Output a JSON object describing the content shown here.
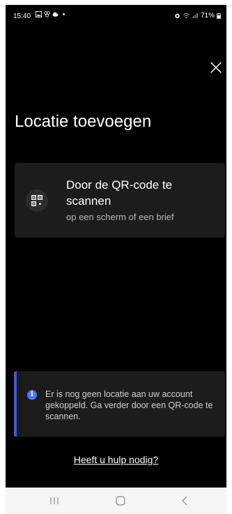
{
  "status_bar": {
    "time": "15:40",
    "battery": "71%",
    "left_icons": [
      "gallery-icon",
      "link-icon",
      "cloud-icon",
      "dot-icon"
    ],
    "right_icons": [
      "alarm-icon",
      "wifi-icon",
      "signal-icon",
      "battery-icon"
    ]
  },
  "header": {
    "title": "Locatie toevoegen",
    "close_icon": "close-icon"
  },
  "qr_option": {
    "icon": "qr-code-icon",
    "title": "Door de QR-code te scannen",
    "subtitle": "op een scherm of een brief"
  },
  "info": {
    "icon": "info-icon",
    "text": "Er is nog geen locatie aan uw account gekoppeld. Ga verder door een QR-code te scannen.",
    "accent_color": "#3b5ce6"
  },
  "help_link": "Heeft u hulp nodig?",
  "nav_bar": {
    "items": [
      "recents-icon",
      "home-icon",
      "back-icon"
    ]
  }
}
